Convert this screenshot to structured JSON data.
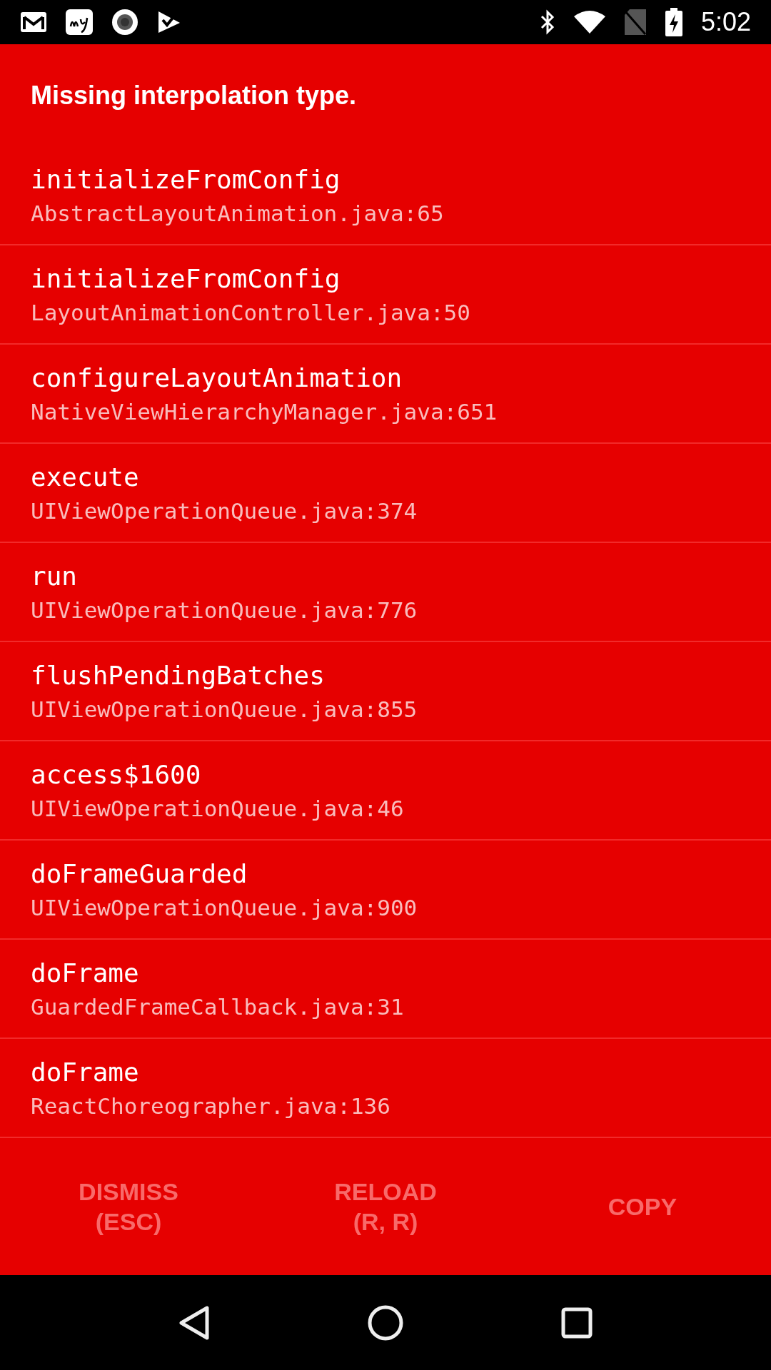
{
  "status_bar": {
    "time": "5:02"
  },
  "title": "Missing interpolation type.",
  "stack_frames": [
    {
      "method": "initializeFromConfig",
      "location": "AbstractLayoutAnimation.java:65"
    },
    {
      "method": "initializeFromConfig",
      "location": "LayoutAnimationController.java:50"
    },
    {
      "method": "configureLayoutAnimation",
      "location": "NativeViewHierarchyManager.java:651"
    },
    {
      "method": "execute",
      "location": "UIViewOperationQueue.java:374"
    },
    {
      "method": "run",
      "location": "UIViewOperationQueue.java:776"
    },
    {
      "method": "flushPendingBatches",
      "location": "UIViewOperationQueue.java:855"
    },
    {
      "method": "access$1600",
      "location": "UIViewOperationQueue.java:46"
    },
    {
      "method": "doFrameGuarded",
      "location": "UIViewOperationQueue.java:900"
    },
    {
      "method": "doFrame",
      "location": "GuardedFrameCallback.java:31"
    },
    {
      "method": "doFrame",
      "location": "ReactChoreographer.java:136"
    }
  ],
  "buttons": [
    {
      "lines": [
        "DISMISS",
        "(ESC)"
      ]
    },
    {
      "lines": [
        "RELOAD",
        "(R, R)"
      ]
    },
    {
      "lines": [
        "COPY"
      ]
    }
  ]
}
